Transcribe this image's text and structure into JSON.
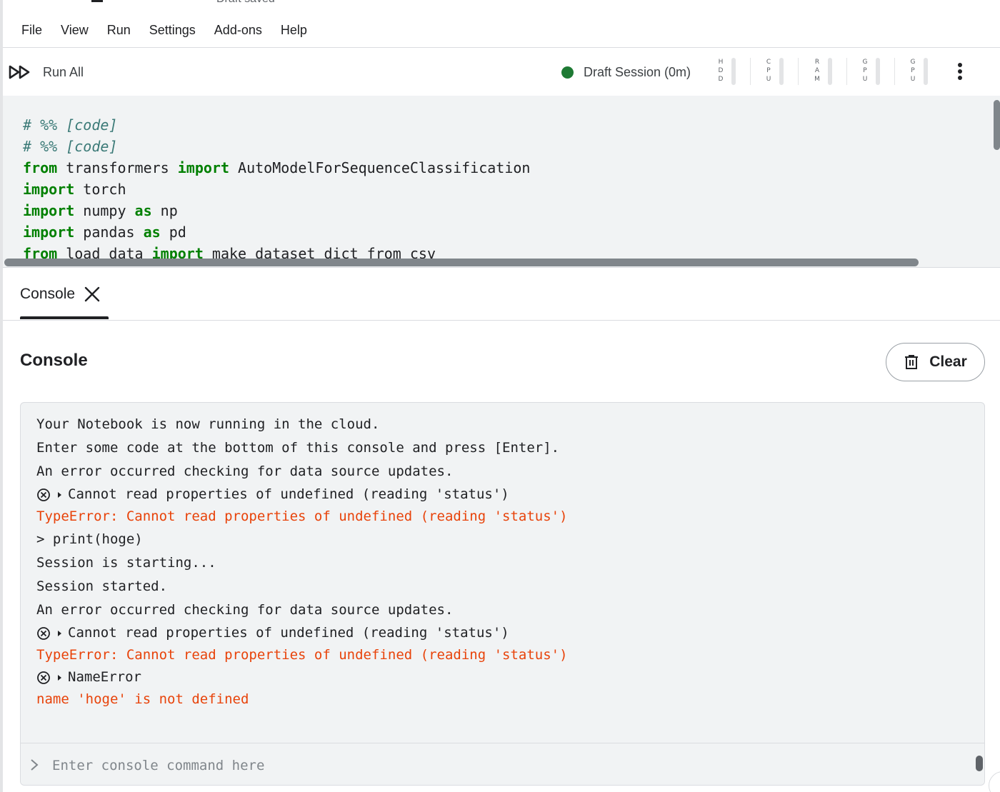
{
  "top": {
    "draft_status": "Draft saved"
  },
  "menu": [
    "File",
    "View",
    "Run",
    "Settings",
    "Add-ons",
    "Help"
  ],
  "toolbar": {
    "run_all_label": "Run All",
    "session_label": "Draft Session (0m)",
    "session_dot_color": "#1e7a34",
    "meters": [
      {
        "letters": [
          "H",
          "D",
          "D"
        ],
        "level": 0.0
      },
      {
        "letters": [
          "C",
          "P",
          "U"
        ],
        "level": 0.0
      },
      {
        "letters": [
          "R",
          "A",
          "M"
        ],
        "level": 0.0
      },
      {
        "letters": [
          "G",
          "P",
          "U"
        ],
        "level": 0.0
      },
      {
        "letters": [
          "G",
          "P",
          "U"
        ],
        "level": 0.0
      }
    ]
  },
  "code": {
    "lines": [
      [
        {
          "t": "# %% [code]",
          "c": "comment"
        }
      ],
      [
        {
          "t": "# %% [code]",
          "c": "comment"
        }
      ],
      [
        {
          "t": "from",
          "c": "kw"
        },
        {
          "t": " transformers ",
          "c": ""
        },
        {
          "t": "import",
          "c": "kw"
        },
        {
          "t": " AutoModelForSequenceClassification",
          "c": ""
        }
      ],
      [
        {
          "t": "import",
          "c": "kw"
        },
        {
          "t": " torch",
          "c": ""
        }
      ],
      [
        {
          "t": "import",
          "c": "kw"
        },
        {
          "t": " numpy ",
          "c": ""
        },
        {
          "t": "as",
          "c": "kw"
        },
        {
          "t": " np",
          "c": ""
        }
      ],
      [
        {
          "t": "import",
          "c": "kw"
        },
        {
          "t": " pandas ",
          "c": ""
        },
        {
          "t": "as",
          "c": "kw"
        },
        {
          "t": " pd",
          "c": ""
        }
      ],
      [
        {
          "t": "from",
          "c": "kw"
        },
        {
          "t": " load_data ",
          "c": ""
        },
        {
          "t": "import",
          "c": "kw"
        },
        {
          "t": " make_dataset_dict_from_csv",
          "c": ""
        }
      ]
    ]
  },
  "console": {
    "tab_label": "Console",
    "heading": "Console",
    "clear_label": "Clear",
    "input_placeholder": "Enter console command here",
    "output": [
      {
        "text": "Your Notebook is now running in the cloud.",
        "kind": "info",
        "tall": true
      },
      {
        "text": "Enter some code at the bottom of this console and press [Enter].",
        "kind": "info",
        "tall": true
      },
      {
        "text": "An error occurred checking for data source updates.",
        "kind": "info",
        "tall": true
      },
      {
        "text": "Cannot read properties of undefined (reading 'status')",
        "kind": "collapsed"
      },
      {
        "text": "TypeError: Cannot read properties of undefined (reading 'status')",
        "kind": "error"
      },
      {
        "text": "> print(hoge)",
        "kind": "info",
        "tall": true
      },
      {
        "text": "Session is starting...",
        "kind": "info",
        "tall": true
      },
      {
        "text": "Session started.",
        "kind": "info",
        "tall": true
      },
      {
        "text": "An error occurred checking for data source updates.",
        "kind": "info",
        "tall": true
      },
      {
        "text": "Cannot read properties of undefined (reading 'status')",
        "kind": "collapsed"
      },
      {
        "text": "TypeError: Cannot read properties of undefined (reading 'status')",
        "kind": "error"
      },
      {
        "text": "NameError",
        "kind": "collapsed"
      },
      {
        "text": "name 'hoge' is not defined",
        "kind": "error"
      }
    ]
  },
  "colors": {
    "accent_error": "#e8430a",
    "keyword": "#008000",
    "comment": "#3b7a77"
  }
}
